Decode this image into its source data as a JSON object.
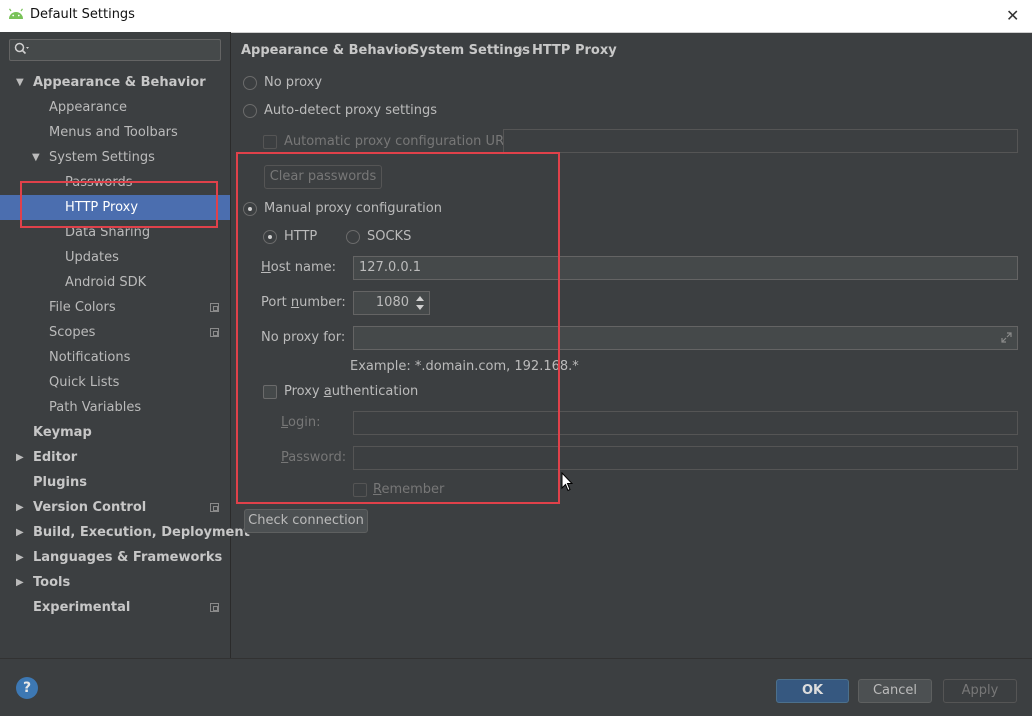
{
  "window": {
    "title": "Default Settings",
    "close_glyph": "✕"
  },
  "search": {
    "placeholder": ""
  },
  "sidebar": {
    "items": [
      {
        "label": "Appearance & Behavior"
      },
      {
        "label": "Appearance"
      },
      {
        "label": "Menus and Toolbars"
      },
      {
        "label": "System Settings"
      },
      {
        "label": "Passwords"
      },
      {
        "label": "HTTP Proxy"
      },
      {
        "label": "Data Sharing"
      },
      {
        "label": "Updates"
      },
      {
        "label": "Android SDK"
      },
      {
        "label": "File Colors"
      },
      {
        "label": "Scopes"
      },
      {
        "label": "Notifications"
      },
      {
        "label": "Quick Lists"
      },
      {
        "label": "Path Variables"
      },
      {
        "label": "Keymap"
      },
      {
        "label": "Editor"
      },
      {
        "label": "Plugins"
      },
      {
        "label": "Version Control"
      },
      {
        "label": "Build, Execution, Deployment"
      },
      {
        "label": "Languages & Frameworks"
      },
      {
        "label": "Tools"
      },
      {
        "label": "Experimental"
      }
    ]
  },
  "breadcrumb": {
    "items": [
      "Appearance & Behavior",
      "System Settings",
      "HTTP Proxy"
    ],
    "separator": "›"
  },
  "proxy": {
    "no_proxy": "No proxy",
    "auto_detect": "Auto-detect proxy settings",
    "auto_config_url": "Automatic proxy configuration URL:",
    "auto_config_url_value": "",
    "clear_passwords": "Clear passwords",
    "manual": "Manual proxy configuration",
    "http": "HTTP",
    "socks": "SOCKS",
    "host_label": {
      "first": "H",
      "rest": "ost name:"
    },
    "host_value": "127.0.0.1",
    "port_label": {
      "first": "Port ",
      "u": "n",
      "rest": "umber:"
    },
    "port_value": "1080",
    "no_proxy_for_label": "No proxy for:",
    "no_proxy_for_value": "",
    "example": "Example: *.domain.com, 192.168.*",
    "auth_label": {
      "first": "Proxy ",
      "u": "a",
      "rest": "uthentication"
    },
    "login_label": {
      "u": "L",
      "rest": "ogin:"
    },
    "password_label": {
      "u": "P",
      "rest": "assword:"
    },
    "login_value": "",
    "password_value": "",
    "remember_label": {
      "u": "R",
      "rest": "emember"
    },
    "check_connection": "Check connection"
  },
  "footer": {
    "help": "?",
    "ok": "OK",
    "cancel": "Cancel",
    "apply": "Apply"
  },
  "colors": {
    "selection": "#4b6eaf",
    "highlight": "#e0414a",
    "background": "#3c3f41"
  }
}
